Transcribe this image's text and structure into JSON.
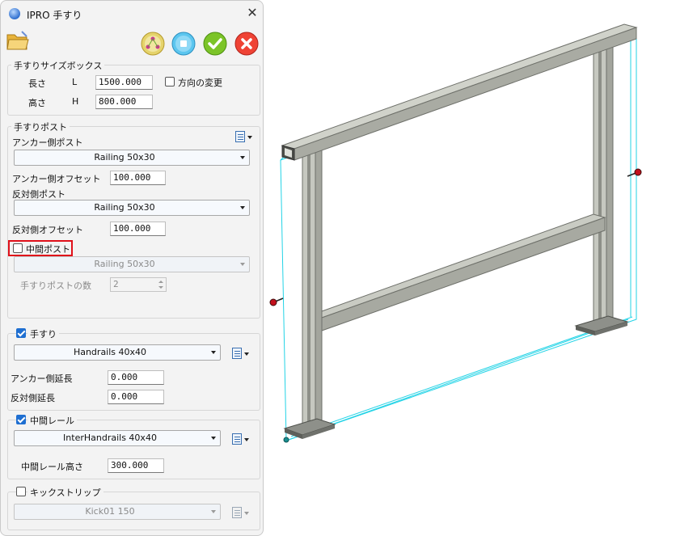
{
  "window": {
    "title": "IPRO 手すり",
    "close_symbol": "✕"
  },
  "toolbar": {
    "folder_icon": "folder-open-icon",
    "pick_icon": "pick-point-icon",
    "stop_icon": "stop-icon",
    "ok_icon": "ok-icon",
    "cancel_icon": "cancel-icon"
  },
  "size_box": {
    "title": "手すりサイズボックス",
    "length_label": "長さ",
    "length_symbol": "L",
    "length_value": "1500.000",
    "height_label": "高さ",
    "height_symbol": "H",
    "height_value": "800.000",
    "direction_label": "方向の変更",
    "direction_checked": false
  },
  "posts": {
    "title": "手すりポスト",
    "anchor_post_label": "アンカー側ポスト",
    "anchor_post_value": "Railing 50x30",
    "anchor_offset_label": "アンカー側オフセット",
    "anchor_offset_value": "100.000",
    "opposite_post_label": "反対側ポスト",
    "opposite_post_value": "Railing 50x30",
    "opposite_offset_label": "反対側オフセット",
    "opposite_offset_value": "100.000",
    "middle_post_label": "中間ポスト",
    "middle_post_checked": false,
    "middle_post_value": "Railing 50x30",
    "count_label": "手すりポストの数",
    "count_value": "2"
  },
  "handrail": {
    "title": "手すり",
    "checked": true,
    "value": "Handrails 40x40",
    "anchor_ext_label": "アンカー側延長",
    "anchor_ext_value": "0.000",
    "opposite_ext_label": "反対側延長",
    "opposite_ext_value": "0.000"
  },
  "mid_rail": {
    "title": "中間レール",
    "checked": true,
    "value": "InterHandrails 40x40",
    "height_label": "中間レール高さ",
    "height_value": "300.000"
  },
  "kick_strip": {
    "title": "キックストリップ",
    "checked": false,
    "value": "Kick01 150"
  },
  "colors": {
    "accent": "#1f6fd1",
    "highlight": "#e0101a",
    "model_gray": "#b9bbb3",
    "selection_cyan": "#22d3e6"
  }
}
